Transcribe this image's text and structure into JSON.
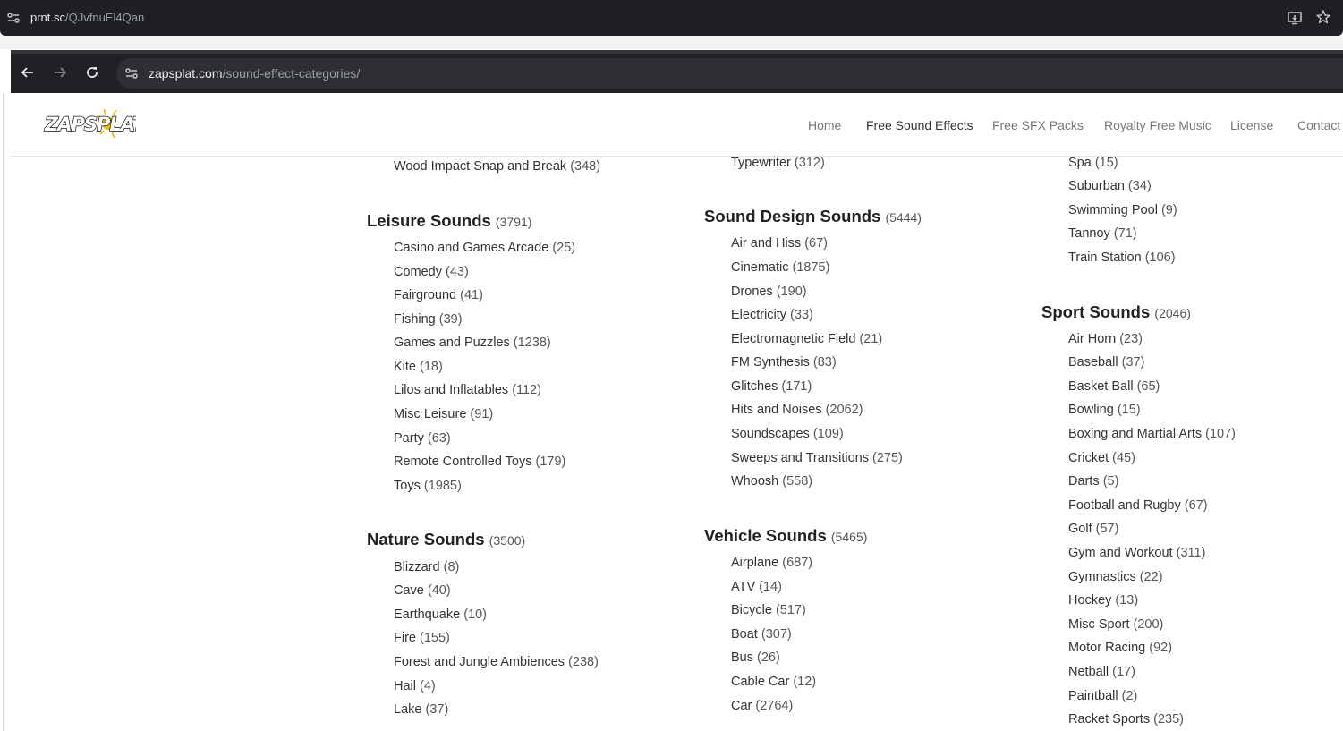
{
  "outer_browser": {
    "url_host": "prnt.sc",
    "url_path": "/QJvfnuEl4Qan"
  },
  "inner_browser": {
    "url_host": "zapsplat.com",
    "url_path": "/sound-effect-categories/"
  },
  "site": {
    "logo_text": "ZAPSPLAT",
    "nav": [
      "Home",
      "Free Sound Effects",
      "Free SFX Packs",
      "Royalty Free Music",
      "License",
      "Contact"
    ],
    "active_nav": "Free Sound Effects"
  },
  "columns": [
    {
      "blocks": [
        {
          "title": "",
          "count": "",
          "items": [
            {
              "name": "Wood Impact Snap and Break",
              "count": "(348)"
            }
          ]
        },
        {
          "title": "Leisure Sounds",
          "count": "(3791)",
          "items": [
            {
              "name": "Casino and Games Arcade",
              "count": "(25)"
            },
            {
              "name": "Comedy",
              "count": "(43)"
            },
            {
              "name": "Fairground",
              "count": "(41)"
            },
            {
              "name": "Fishing",
              "count": "(39)"
            },
            {
              "name": "Games and Puzzles",
              "count": "(1238)"
            },
            {
              "name": "Kite",
              "count": "(18)"
            },
            {
              "name": "Lilos and Inflatables",
              "count": "(112)"
            },
            {
              "name": "Misc Leisure",
              "count": "(91)"
            },
            {
              "name": "Party",
              "count": "(63)"
            },
            {
              "name": "Remote Controlled Toys",
              "count": "(179)"
            },
            {
              "name": "Toys",
              "count": "(1985)"
            }
          ]
        },
        {
          "title": "Nature Sounds",
          "count": "(3500)",
          "items": [
            {
              "name": "Blizzard",
              "count": "(8)"
            },
            {
              "name": "Cave",
              "count": "(40)"
            },
            {
              "name": "Earthquake",
              "count": "(10)"
            },
            {
              "name": "Fire",
              "count": "(155)"
            },
            {
              "name": "Forest and Jungle Ambiences",
              "count": "(238)"
            },
            {
              "name": "Hail",
              "count": "(4)"
            },
            {
              "name": "Lake",
              "count": "(37)"
            }
          ]
        }
      ]
    },
    {
      "blocks": [
        {
          "title": "",
          "count": "",
          "items": [
            {
              "name": "Typewriter",
              "count": "(312)"
            }
          ]
        },
        {
          "title": "Sound Design Sounds",
          "count": "(5444)",
          "items": [
            {
              "name": "Air and Hiss",
              "count": "(67)"
            },
            {
              "name": "Cinematic",
              "count": "(1875)"
            },
            {
              "name": "Drones",
              "count": "(190)"
            },
            {
              "name": "Electricity",
              "count": "(33)"
            },
            {
              "name": "Electromagnetic Field",
              "count": "(21)"
            },
            {
              "name": "FM Synthesis",
              "count": "(83)"
            },
            {
              "name": "Glitches",
              "count": "(171)"
            },
            {
              "name": "Hits and Noises",
              "count": "(2062)"
            },
            {
              "name": "Soundscapes",
              "count": "(109)"
            },
            {
              "name": "Sweeps and Transitions",
              "count": "(275)"
            },
            {
              "name": "Whoosh",
              "count": "(558)"
            }
          ]
        },
        {
          "title": "Vehicle Sounds",
          "count": "(5465)",
          "items": [
            {
              "name": "Airplane",
              "count": "(687)"
            },
            {
              "name": "ATV",
              "count": "(14)"
            },
            {
              "name": "Bicycle",
              "count": "(517)"
            },
            {
              "name": "Boat",
              "count": "(307)"
            },
            {
              "name": "Bus",
              "count": "(26)"
            },
            {
              "name": "Cable Car",
              "count": "(12)"
            },
            {
              "name": "Car",
              "count": "(2764)"
            }
          ]
        }
      ]
    },
    {
      "blocks": [
        {
          "title": "",
          "count": "",
          "items": [
            {
              "name": "Spa",
              "count": "(15)"
            },
            {
              "name": "Suburban",
              "count": "(34)"
            },
            {
              "name": "Swimming Pool",
              "count": "(9)"
            },
            {
              "name": "Tannoy",
              "count": "(71)"
            },
            {
              "name": "Train Station",
              "count": "(106)"
            }
          ]
        },
        {
          "title": "Sport Sounds",
          "count": "(2046)",
          "items": [
            {
              "name": "Air Horn",
              "count": "(23)"
            },
            {
              "name": "Baseball",
              "count": "(37)"
            },
            {
              "name": "Basket Ball",
              "count": "(65)"
            },
            {
              "name": "Bowling",
              "count": "(15)"
            },
            {
              "name": "Boxing and Martial Arts",
              "count": "(107)"
            },
            {
              "name": "Cricket",
              "count": "(45)"
            },
            {
              "name": "Darts",
              "count": "(5)"
            },
            {
              "name": "Football and Rugby",
              "count": "(67)"
            },
            {
              "name": "Golf",
              "count": "(57)"
            },
            {
              "name": "Gym and Workout",
              "count": "(311)"
            },
            {
              "name": "Gymnastics",
              "count": "(22)"
            },
            {
              "name": "Hockey",
              "count": "(13)"
            },
            {
              "name": "Misc Sport",
              "count": "(200)"
            },
            {
              "name": "Motor Racing",
              "count": "(92)"
            },
            {
              "name": "Netball",
              "count": "(17)"
            },
            {
              "name": "Paintball",
              "count": "(2)"
            },
            {
              "name": "Racket Sports",
              "count": "(235)"
            }
          ]
        }
      ]
    }
  ],
  "colors": {
    "title": "#222222",
    "link": "#333333",
    "count": "#555555",
    "nav": "#777777"
  }
}
